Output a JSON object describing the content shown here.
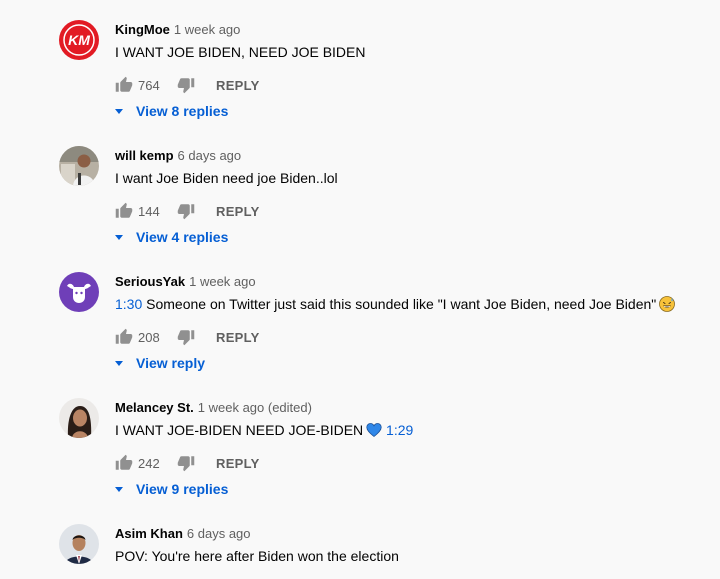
{
  "comments": [
    {
      "author": "KingMoe",
      "time": "1 week ago",
      "text": "I WANT JOE BIDEN, NEED JOE BIDEN",
      "likes": "764",
      "reply_label": "REPLY",
      "view_replies": "View 8 replies",
      "avatar_icon": "km-logo-avatar"
    },
    {
      "author": "will kemp",
      "time": "6 days ago",
      "text": "I want  Joe Biden need joe Biden..lol",
      "likes": "144",
      "reply_label": "REPLY",
      "view_replies": "View 4 replies",
      "avatar_icon": "photo-avatar"
    },
    {
      "author": "SeriousYak",
      "time": "1 week ago",
      "timestamp": "1:30",
      "text": "Someone on Twitter just said this sounded like \"I want Joe Biden, need Joe Biden\"",
      "emoji": "grinning-sweat-emoji",
      "likes": "208",
      "reply_label": "REPLY",
      "view_replies": "View reply",
      "avatar_icon": "yak-avatar"
    },
    {
      "author": "Melancey St.",
      "time": "1 week ago (edited)",
      "text": "I WANT JOE-BIDEN NEED JOE-BIDEN",
      "emoji": "blue-heart-emoji",
      "timestamp": "1:29",
      "likes": "242",
      "reply_label": "REPLY",
      "view_replies": "View 9 replies",
      "avatar_icon": "photo-avatar"
    },
    {
      "author": "Asim Khan",
      "time": "6 days ago",
      "text": "POV: You're here after Biden won the election",
      "avatar_icon": "photo-avatar"
    }
  ],
  "colors": {
    "background": "#f9f9f9",
    "link_blue": "#065fd4",
    "secondary_text": "#606060",
    "primary_text": "#030303"
  }
}
